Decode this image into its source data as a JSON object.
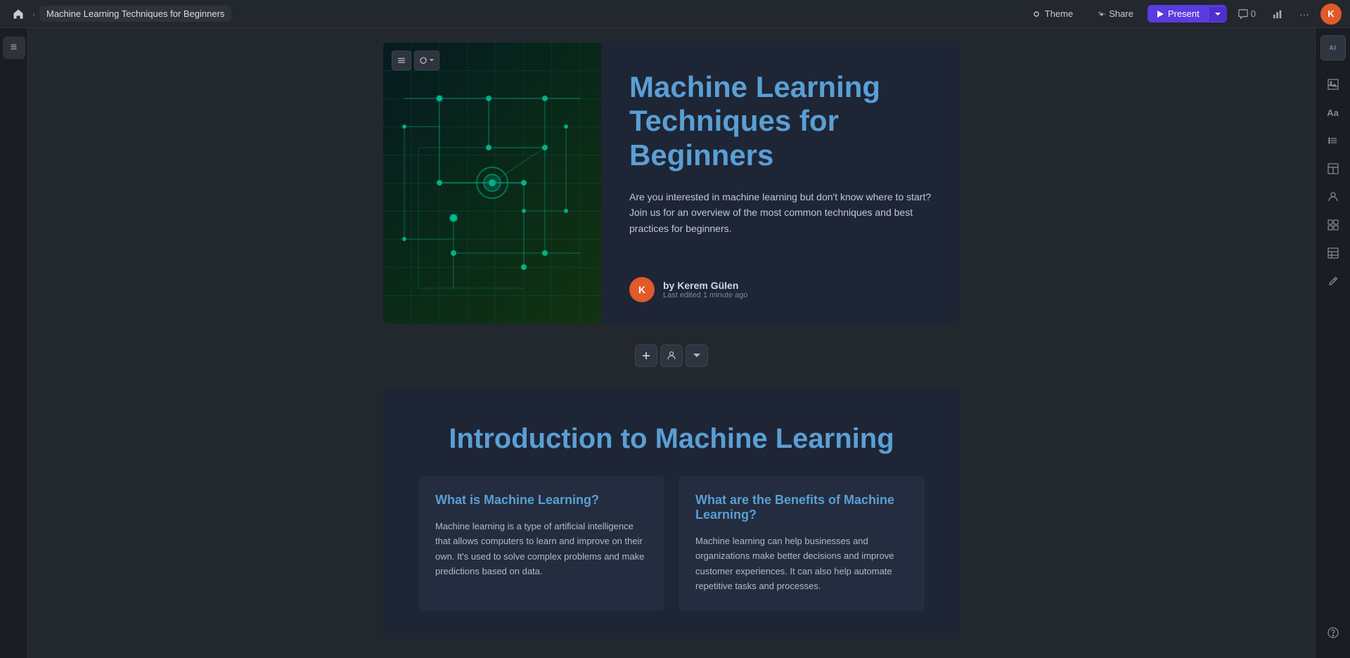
{
  "topbar": {
    "home_label": "Home",
    "breadcrumb_sep": "›",
    "doc_title": "Machine Learning Techniques for Beginners",
    "theme_label": "Theme",
    "share_label": "Share",
    "present_label": "Present",
    "comment_count": "0",
    "avatar_initials": "K"
  },
  "sidebar_toggle_icon": "≡",
  "slide1": {
    "main_title": "Machine Learning Techniques for Beginners",
    "description": "Are you interested in machine learning but don't know where to start? Join us for an overview of the most common techniques and best practices for beginners.",
    "author_initials": "K",
    "author_by": "by Kerem Gülen",
    "author_edited": "Last edited 1 minute ago"
  },
  "slide2": {
    "title": "Introduction to Machine Learning",
    "card1": {
      "title": "What is Machine Learning?",
      "body": "Machine learning is a type of artificial intelligence that allows computers to learn and improve on their own. It's used to solve complex problems and make predictions based on data."
    },
    "card2": {
      "title": "What are the Benefits of Machine Learning?",
      "body": "Machine learning can help businesses and organizations make better decisions and improve customer experiences. It can also help automate repetitive tasks and processes."
    }
  },
  "right_sidebar": {
    "ai_label": "AI",
    "btn2_icon": "⊙",
    "btn3_label": "Aa",
    "btn4_icon": "≡",
    "btn5_icon": "⬜",
    "btn6_icon": "👤",
    "btn7_icon": "⊞",
    "btn8_icon": "▤",
    "btn9_icon": "✎",
    "help_icon": "?"
  }
}
